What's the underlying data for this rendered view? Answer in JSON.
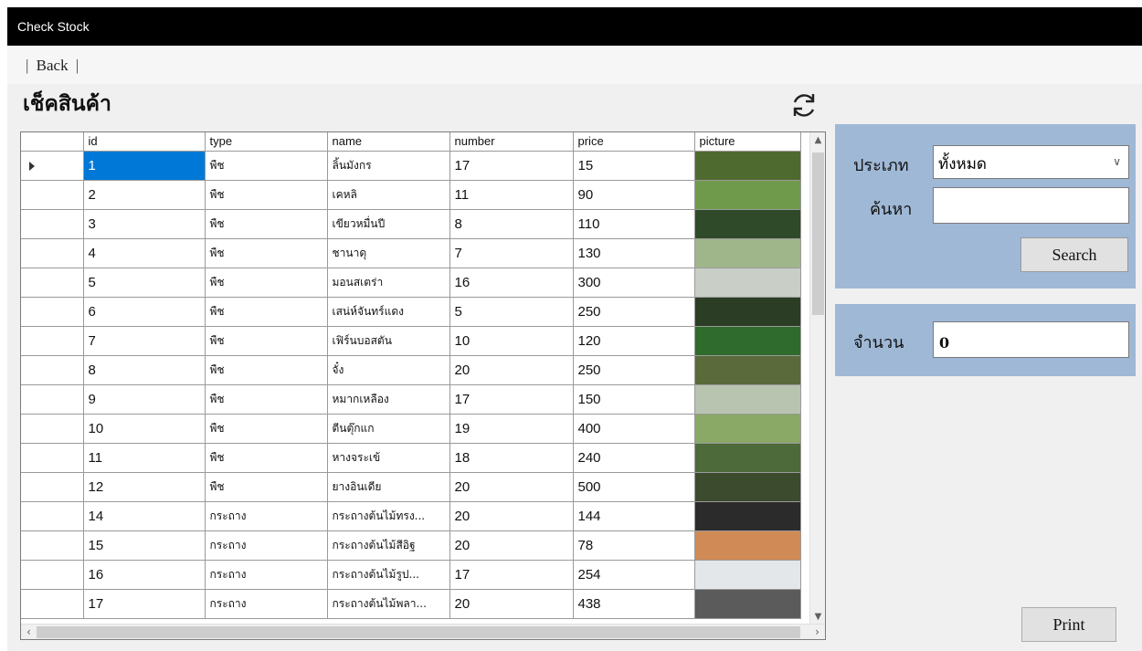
{
  "window": {
    "title": "Check Stock"
  },
  "menu": {
    "back_label": "Back",
    "separator": "|"
  },
  "page": {
    "title": "เช็คสินค้า"
  },
  "grid": {
    "columns": [
      "id",
      "type",
      "name",
      "number",
      "price",
      "picture"
    ],
    "selected_row": 0,
    "rows": [
      {
        "id": "1",
        "type": "พืช",
        "name": "ลิ้นมังกร",
        "number": "17",
        "price": "15",
        "picture_color": "#4f6a2e"
      },
      {
        "id": "2",
        "type": "พืช",
        "name": "เคหลิ",
        "number": "11",
        "price": "90",
        "picture_color": "#6f9a4c"
      },
      {
        "id": "3",
        "type": "พืช",
        "name": "เขียวหมื่นปี",
        "number": "8",
        "price": "110",
        "picture_color": "#2f4a28"
      },
      {
        "id": "4",
        "type": "พืช",
        "name": "ชานาดุ",
        "number": "7",
        "price": "130",
        "picture_color": "#9fb68a"
      },
      {
        "id": "5",
        "type": "พืช",
        "name": "มอนสเตร่า",
        "number": "16",
        "price": "300",
        "picture_color": "#c9cfc6"
      },
      {
        "id": "6",
        "type": "พืช",
        "name": "เสน่ห์จันทร์แดง",
        "number": "5",
        "price": "250",
        "picture_color": "#2c3d25"
      },
      {
        "id": "7",
        "type": "พืช",
        "name": "เฟิร์นบอสตัน",
        "number": "10",
        "price": "120",
        "picture_color": "#2f6b2c"
      },
      {
        "id": "8",
        "type": "พืช",
        "name": "จั๋ง",
        "number": "20",
        "price": "250",
        "picture_color": "#5a6a3a"
      },
      {
        "id": "9",
        "type": "พืช",
        "name": "หมากเหลือง",
        "number": "17",
        "price": "150",
        "picture_color": "#b9c4b0"
      },
      {
        "id": "10",
        "type": "พืช",
        "name": "ตีนตุ๊กแก",
        "number": "19",
        "price": "400",
        "picture_color": "#8aa866"
      },
      {
        "id": "11",
        "type": "พืช",
        "name": "หางจระเข้",
        "number": "18",
        "price": "240",
        "picture_color": "#4d6a3a"
      },
      {
        "id": "12",
        "type": "พืช",
        "name": "ยางอินเดีย",
        "number": "20",
        "price": "500",
        "picture_color": "#3c4a2e"
      },
      {
        "id": "14",
        "type": "กระถาง",
        "name": "กระถางต้นไม้ทรง...",
        "number": "20",
        "price": "144",
        "picture_color": "#2b2b2b"
      },
      {
        "id": "15",
        "type": "กระถาง",
        "name": "กระถางต้นไม้สีอิฐ",
        "number": "20",
        "price": "78",
        "picture_color": "#d08a55"
      },
      {
        "id": "16",
        "type": "กระถาง",
        "name": "กระถางต้นไม้รูป...",
        "number": "17",
        "price": "254",
        "picture_color": "#e4e7ea"
      },
      {
        "id": "17",
        "type": "กระถาง",
        "name": "กระถางต้นไม้พลา...",
        "number": "20",
        "price": "438",
        "picture_color": "#5b5b5b"
      }
    ]
  },
  "filter": {
    "type_label": "ประเภท",
    "type_value": "ทั้งหมด",
    "search_label": "ค้นหา",
    "search_value": "",
    "search_button": "Search"
  },
  "count": {
    "label": "จำนวน",
    "value": "0"
  },
  "actions": {
    "print_button": "Print"
  },
  "colors": {
    "panel": "#9fb8d6",
    "selection": "#0078d7",
    "titlebar": "#000000"
  }
}
